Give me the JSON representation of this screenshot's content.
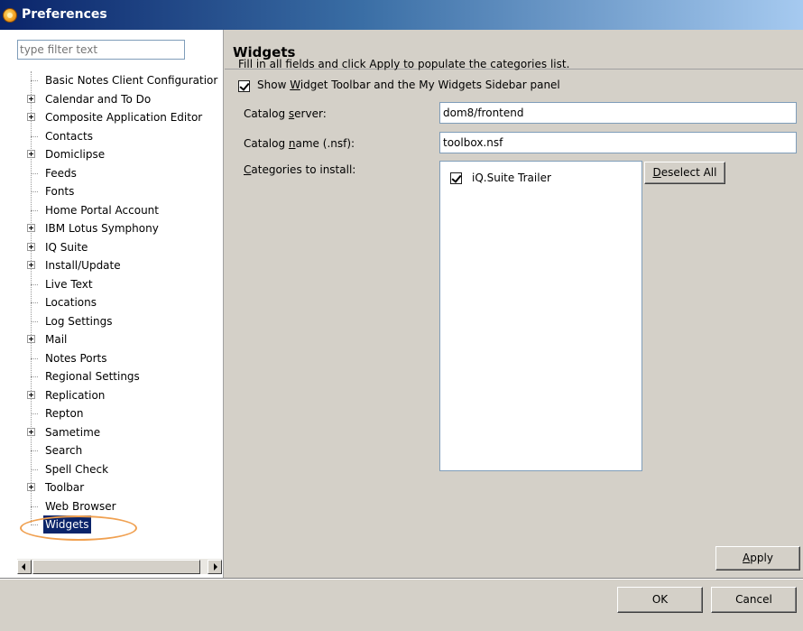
{
  "window": {
    "title": "Preferences"
  },
  "left": {
    "filter_placeholder": "type filter text",
    "tree": [
      {
        "label": "Basic Notes Client Configuratior",
        "expandable": false
      },
      {
        "label": "Calendar and To Do",
        "expandable": true
      },
      {
        "label": "Composite Application Editor",
        "expandable": true
      },
      {
        "label": "Contacts",
        "expandable": false
      },
      {
        "label": "Domiclipse",
        "expandable": true
      },
      {
        "label": "Feeds",
        "expandable": false
      },
      {
        "label": "Fonts",
        "expandable": false
      },
      {
        "label": "Home Portal Account",
        "expandable": false
      },
      {
        "label": "IBM Lotus Symphony",
        "expandable": true
      },
      {
        "label": "IQ Suite",
        "expandable": true
      },
      {
        "label": "Install/Update",
        "expandable": true
      },
      {
        "label": "Live Text",
        "expandable": false
      },
      {
        "label": "Locations",
        "expandable": false
      },
      {
        "label": "Log Settings",
        "expandable": false
      },
      {
        "label": "Mail",
        "expandable": true
      },
      {
        "label": "Notes Ports",
        "expandable": false
      },
      {
        "label": "Regional Settings",
        "expandable": false
      },
      {
        "label": "Replication",
        "expandable": true
      },
      {
        "label": "Repton",
        "expandable": false
      },
      {
        "label": "Sametime",
        "expandable": true
      },
      {
        "label": "Search",
        "expandable": false
      },
      {
        "label": "Spell Check",
        "expandable": false
      },
      {
        "label": "Toolbar",
        "expandable": true
      },
      {
        "label": "Web Browser",
        "expandable": false
      },
      {
        "label": "Widgets",
        "expandable": false,
        "selected": true
      }
    ]
  },
  "page": {
    "title": "Widgets",
    "instructions": "Fill in all fields and click Apply to populate the categories list.",
    "show_toolbar": {
      "checked": true,
      "label_pre": "Show ",
      "label_mnemonic": "W",
      "label_post": "idget Toolbar and the My Widgets Sidebar panel"
    },
    "catalog_server": {
      "label_pre": "Catalog ",
      "label_mnemonic": "s",
      "label_post": "erver:",
      "value": "dom8/frontend"
    },
    "catalog_name": {
      "label_pre": "Catalog ",
      "label_mnemonic": "n",
      "label_post": "ame (.nsf):",
      "value": "toolbox.nsf"
    },
    "categories": {
      "label_mnemonic": "C",
      "label_post": "ategories to install:",
      "items": [
        {
          "label": "iQ.Suite Trailer",
          "checked": true
        }
      ]
    },
    "deselect_all": {
      "mnemonic": "D",
      "rest": "eselect All"
    },
    "apply": {
      "mnemonic": "A",
      "rest": "pply"
    }
  },
  "footer": {
    "ok": "OK",
    "cancel": "Cancel"
  },
  "colors": {
    "selection": "#0a246a",
    "dialog_bg": "#d4d0c8",
    "highlight_ring": "#f0a050"
  }
}
